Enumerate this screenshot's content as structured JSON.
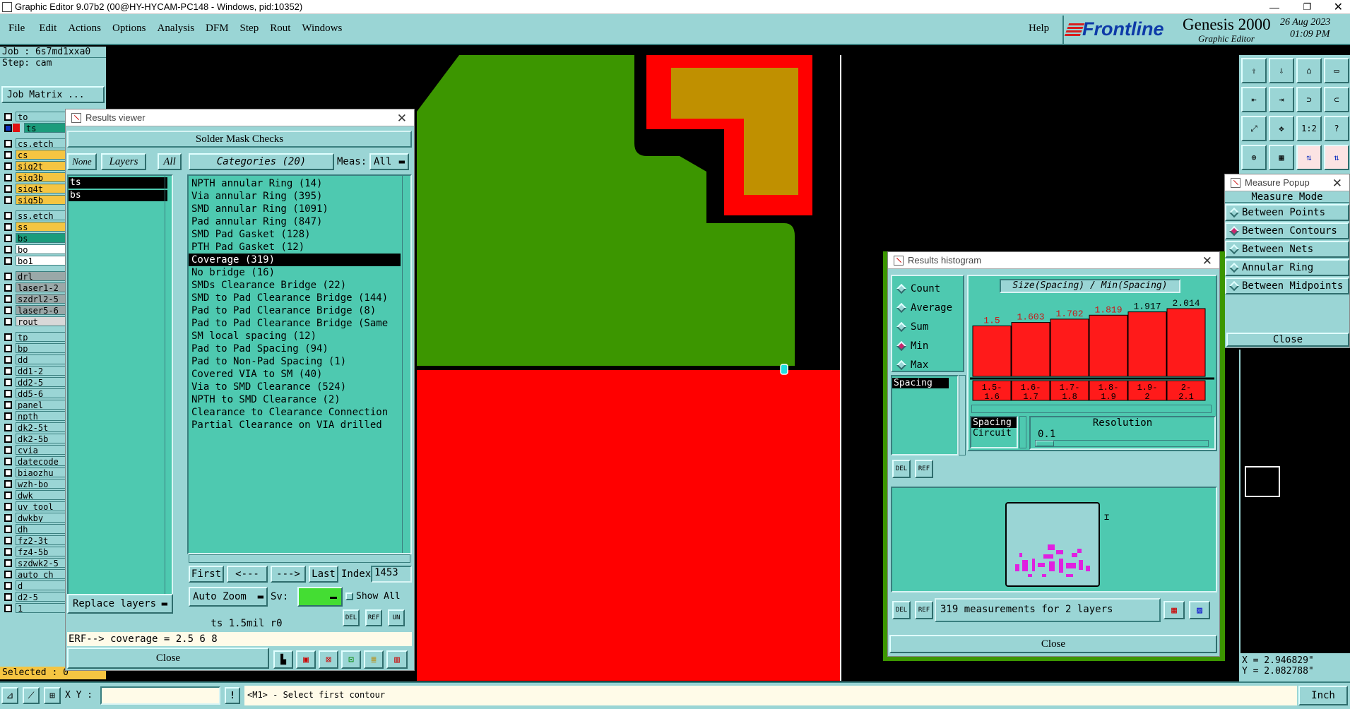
{
  "window": {
    "title": "Graphic Editor 9.07b2 (00@HY-HYCAM-PC148 - Windows, pid:10352)"
  },
  "menu": [
    "File",
    "Edit",
    "Actions",
    "Options",
    "Analysis",
    "DFM",
    "Step",
    "Rout",
    "Windows"
  ],
  "help": "Help",
  "brand": {
    "logo": "Frontline",
    "product": "Genesis 2000",
    "subtitle": "Graphic Editor",
    "date": "26 Aug 2023",
    "time": "01:09 PM"
  },
  "job": {
    "job": "Job : 6s7md1xxa0",
    "step": "Step: cam",
    "matrix_button": "Job Matrix ..."
  },
  "layers": [
    {
      "name": "to",
      "color": "#9ad5d5"
    },
    {
      "name": "ts",
      "color": "#1c9c7c"
    },
    {
      "name": "cs.etch",
      "color": "#9ad5d5"
    },
    {
      "name": "cs",
      "color": "#f5c542"
    },
    {
      "name": "sig2t",
      "color": "#f5c542"
    },
    {
      "name": "sig3b",
      "color": "#f5c542"
    },
    {
      "name": "sig4t",
      "color": "#f5c542"
    },
    {
      "name": "sig5b",
      "color": "#f5c542"
    },
    {
      "name": "ss.etch",
      "color": "#9ad5d5"
    },
    {
      "name": "ss",
      "color": "#f5c542"
    },
    {
      "name": "bs",
      "color": "#1c9c7c"
    },
    {
      "name": "bo",
      "color": "#ffffff"
    },
    {
      "name": "bo1",
      "color": "#ffffff"
    },
    {
      "name": "drl",
      "color": "#9aa8a8"
    },
    {
      "name": "laser1-2",
      "color": "#9aa8a8"
    },
    {
      "name": "szdrl2-5",
      "color": "#9aa8a8"
    },
    {
      "name": "laser5-6",
      "color": "#9aa8a8"
    },
    {
      "name": "rout",
      "color": "#d8d8d8"
    },
    {
      "name": "tp",
      "color": "#9ad5d5"
    },
    {
      "name": "bp",
      "color": "#9ad5d5"
    },
    {
      "name": "dd",
      "color": "#9ad5d5"
    },
    {
      "name": "dd1-2",
      "color": "#9ad5d5"
    },
    {
      "name": "dd2-5",
      "color": "#9ad5d5"
    },
    {
      "name": "dd5-6",
      "color": "#9ad5d5"
    },
    {
      "name": "panel",
      "color": "#9ad5d5"
    },
    {
      "name": "npth",
      "color": "#9ad5d5"
    },
    {
      "name": "dk2-5t",
      "color": "#9ad5d5"
    },
    {
      "name": "dk2-5b",
      "color": "#9ad5d5"
    },
    {
      "name": "cvia",
      "color": "#9ad5d5"
    },
    {
      "name": "datecode",
      "color": "#9ad5d5"
    },
    {
      "name": "biaozhu",
      "color": "#9ad5d5"
    },
    {
      "name": "wzh-bo",
      "color": "#9ad5d5"
    },
    {
      "name": "dwk",
      "color": "#9ad5d5"
    },
    {
      "name": "uv_tool",
      "color": "#9ad5d5"
    },
    {
      "name": "dwkby",
      "color": "#9ad5d5"
    },
    {
      "name": "dh",
      "color": "#9ad5d5"
    },
    {
      "name": "fz2-3t",
      "color": "#9ad5d5"
    },
    {
      "name": "fz4-5b",
      "color": "#9ad5d5"
    },
    {
      "name": "szdwk2-5",
      "color": "#9ad5d5"
    },
    {
      "name": "auto_ch",
      "color": "#9ad5d5"
    },
    {
      "name": "d",
      "color": "#9ad5d5"
    },
    {
      "name": "d2-5",
      "color": "#9ad5d5"
    },
    {
      "name": "1",
      "color": "#9ad5d5"
    }
  ],
  "selected": "Selected : 0",
  "results_viewer": {
    "title": "Results viewer",
    "header": "Solder Mask Checks",
    "none_btn": "None",
    "layers_btn": "Layers",
    "all_btn": "All",
    "layer_list": [
      "ts",
      "bs"
    ],
    "categories_label": "Categories (20)",
    "meas_label": "Meas:",
    "meas_value": "All",
    "categories": [
      "NPTH annular Ring (14)",
      "Via annular Ring (395)",
      "SMD annular Ring (1091)",
      "Pad annular Ring (847)",
      "SMD Pad Gasket (128)",
      "PTH Pad Gasket (12)",
      "Coverage (319)",
      "No bridge (16)",
      "SMDs Clearance Bridge (22)",
      "SMD to Pad Clearance Bridge (144)",
      "Pad to Pad Clearance Bridge (8)",
      "Pad to Pad Clearance Bridge (Same",
      "SM local spacing (12)",
      "Pad to Pad Spacing (94)",
      "Pad to Non-Pad Spacing (1)",
      "Covered VIA to SM (40)",
      "Via to SMD Clearance (524)",
      "NPTH to SMD Clearance (2)",
      "Clearance to Clearance Connection",
      "Partial Clearance on VIA drilled"
    ],
    "selected_category_index": 6,
    "first": "First",
    "prev": "<---",
    "next": "--->",
    "last": "Last",
    "index_label": "Index:",
    "index_value": "1453",
    "replace_layers": "Replace layers",
    "auto_zoom": "Auto Zoom",
    "sv_label": "Sv:",
    "show_all": "Show All",
    "status_line": "ts 1.5mil  r0",
    "erf_line": "ERF--> coverage = 2.5 6 8",
    "close": "Close"
  },
  "measure_popup": {
    "title": "Measure Popup",
    "mode_label": "Measure Mode",
    "options": [
      "Between Points",
      "Between Contours",
      "Between Nets",
      "Annular Ring",
      "Between Midpoints"
    ],
    "selected_index": 1,
    "close": "Close"
  },
  "histogram": {
    "title": "Results histogram",
    "stats": [
      "Count",
      "Average",
      "Sum",
      "Min",
      "Max"
    ],
    "selected_stat": 3,
    "list_item": "Spacing",
    "chart_title": "Size(Spacing) / Min(Spacing)",
    "type_list": [
      "Spacing",
      "Circuit"
    ],
    "resolution_label": "Resolution",
    "resolution_value": "0.1",
    "summary": "319 measurements for 2 layers",
    "close": "Close"
  },
  "chart_data": {
    "type": "bar",
    "title": "Size(Spacing) / Min(Spacing)",
    "categories": [
      "1.5-1.6",
      "1.6-1.7",
      "1.7-1.8",
      "1.8-1.9",
      "1.9-2",
      "2-2.1"
    ],
    "values": [
      1.5,
      1.603,
      1.702,
      1.819,
      1.917,
      2.014
    ],
    "value_labels": [
      "1.5",
      "1.603",
      "1.702",
      "1.819",
      "1.917",
      "2.014"
    ],
    "ylim": [
      0,
      2.014
    ]
  },
  "coords": {
    "x": "X = 2.946829\"",
    "y": "Y = 2.082788\""
  },
  "bottom": {
    "xy_label": "X Y :",
    "xy_value": "",
    "prompt": "<M1> - Select first contour",
    "units": "Inch"
  },
  "colors": {
    "panel": "#9ad5d5",
    "panel_dark": "#4ec9b0",
    "board_green": "#3c9600",
    "board_red": "#ff0000",
    "gold": "#c09000",
    "bar_red": "#ff1a1a",
    "dark_label": "#c81818"
  }
}
